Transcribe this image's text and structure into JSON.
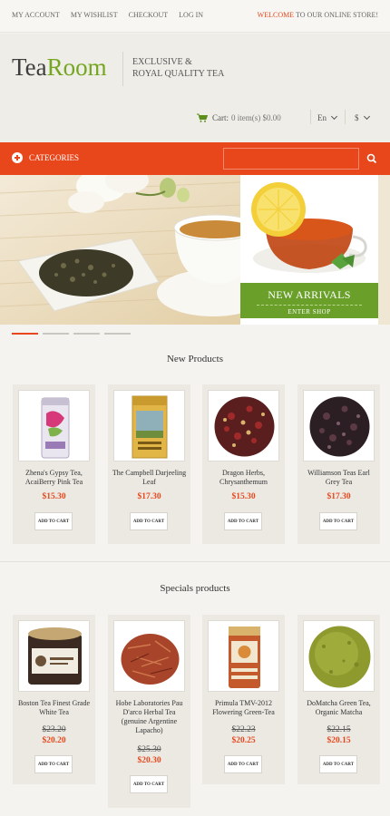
{
  "topbar": {
    "links": [
      "My Account",
      "My Wishlist",
      "Checkout",
      "Log In"
    ],
    "welcome_highlight": "Welcome",
    "welcome_rest": " to our online store!"
  },
  "header": {
    "logo_part1": "Tea",
    "logo_part2": "Room",
    "tagline_line1": "Exclusive &",
    "tagline_line2": "Royal Quality Tea",
    "cart_label": "Cart:",
    "cart_summary": "0 item(s) $0.00",
    "language": "En",
    "currency": "$"
  },
  "nav": {
    "categories_label": "Categories",
    "search_placeholder": ""
  },
  "banner": {
    "title": "New Arrivals",
    "cta": "Enter Shop"
  },
  "new_products": {
    "title": "New Products",
    "items": [
      {
        "name": "Zhena's Gypsy Tea, AcaiBerry Pink Tea",
        "price": "$15.30",
        "button": "Add to Cart"
      },
      {
        "name": "The Campbell Darjeeling Leaf",
        "price": "$17.30",
        "button": "Add to Cart"
      },
      {
        "name": "Dragon Herbs, Chrysanthemum",
        "price": "$15.30",
        "button": "Add to Cart"
      },
      {
        "name": "Williamson Teas Earl Grey Tea",
        "price": "$17.30",
        "button": "Add to Cart"
      }
    ]
  },
  "specials": {
    "title": "Specials products",
    "items": [
      {
        "name": "Boston Tea Finest Grade White Tea",
        "old_price": "$23.20",
        "price": "$20.20",
        "button": "Add to Cart"
      },
      {
        "name": "Hobe Laboratories Pau D'arco Herbal Tea (genuine Argentine Lapacho)",
        "old_price": "$25.30",
        "price": "$20.30",
        "button": "Add to Cart"
      },
      {
        "name": "Primula TMV-2012 Flowering Green-Tea",
        "old_price": "$22.23",
        "price": "$20.25",
        "button": "Add to Cart"
      },
      {
        "name": "DoMatcha Green Tea, Organic Matcha",
        "old_price": "$22.15",
        "price": "$20.15",
        "button": "Add to Cart"
      }
    ]
  },
  "colors": {
    "accent": "#e8471c",
    "brand_green": "#74a620",
    "banner_green": "#6aa02a"
  }
}
